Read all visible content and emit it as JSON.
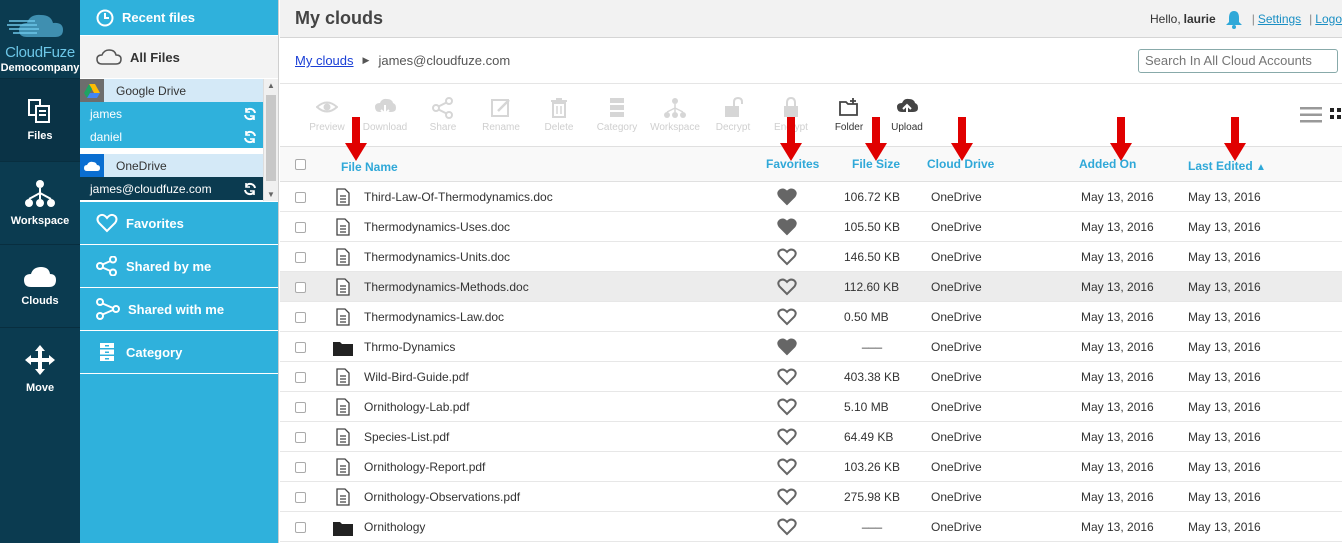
{
  "brand": {
    "name": "CloudFuze",
    "company": "Democompany"
  },
  "rail": [
    {
      "label": "Files",
      "icon": "files-icon"
    },
    {
      "label": "Workspace",
      "icon": "workspace-icon"
    },
    {
      "label": "Clouds",
      "icon": "cloud-icon"
    },
    {
      "label": "Move",
      "icon": "move-icon"
    }
  ],
  "panel": {
    "recent": "Recent files",
    "all_files": "All Files",
    "clouds": [
      {
        "name": "Google Drive",
        "accounts": [
          "james",
          "daniel"
        ]
      },
      {
        "name": "OneDrive",
        "accounts": [
          "james@cloudfuze.com"
        ]
      }
    ],
    "favorites": "Favorites",
    "shared_by_me": "Shared by me",
    "shared_with_me": "Shared with me",
    "category": "Category"
  },
  "header": {
    "title": "My clouds",
    "hello": "Hello,",
    "user": "laurie",
    "settings": "Settings",
    "logout": "Logo"
  },
  "breadcrumb": {
    "root": "My clouds",
    "current": "james@cloudfuze.com"
  },
  "search": {
    "placeholder": "Search In All Cloud Accounts"
  },
  "toolbar": [
    {
      "label": "Preview",
      "icon": "eye-icon",
      "enabled": false
    },
    {
      "label": "Download",
      "icon": "download-icon",
      "enabled": false
    },
    {
      "label": "Share",
      "icon": "share-icon",
      "enabled": false
    },
    {
      "label": "Rename",
      "icon": "rename-icon",
      "enabled": false
    },
    {
      "label": "Delete",
      "icon": "trash-icon",
      "enabled": false
    },
    {
      "label": "Category",
      "icon": "category-icon",
      "enabled": false
    },
    {
      "label": "Workspace",
      "icon": "workspace-icon",
      "enabled": false
    },
    {
      "label": "Decrypt",
      "icon": "unlock-icon",
      "enabled": false
    },
    {
      "label": "Encrypt",
      "icon": "lock-icon",
      "enabled": false
    },
    {
      "label": "Folder",
      "icon": "new-folder-icon",
      "enabled": true
    },
    {
      "label": "Upload",
      "icon": "upload-icon",
      "enabled": true
    }
  ],
  "table": {
    "columns": {
      "name": "File Name",
      "favorites": "Favorites",
      "size": "File Size",
      "drive": "Cloud Drive",
      "added": "Added On",
      "edited": "Last Edited",
      "sort_indicator": "▲"
    },
    "rows": [
      {
        "name": "Third-Law-Of-Thermodynamics.doc",
        "type": "file",
        "fav": true,
        "size": "106.72 KB",
        "drive": "OneDrive",
        "added": "May 13, 2016",
        "edited": "May 13, 2016"
      },
      {
        "name": "Thermodynamics-Uses.doc",
        "type": "file",
        "fav": true,
        "size": "105.50 KB",
        "drive": "OneDrive",
        "added": "May 13, 2016",
        "edited": "May 13, 2016"
      },
      {
        "name": "Thermodynamics-Units.doc",
        "type": "file",
        "fav": false,
        "size": "146.50 KB",
        "drive": "OneDrive",
        "added": "May 13, 2016",
        "edited": "May 13, 2016"
      },
      {
        "name": "Thermodynamics-Methods.doc",
        "type": "file",
        "fav": false,
        "size": "112.60 KB",
        "drive": "OneDrive",
        "added": "May 13, 2016",
        "edited": "May 13, 2016",
        "highlight": true
      },
      {
        "name": "Thermodynamics-Law.doc",
        "type": "file",
        "fav": false,
        "size": "0.50 MB",
        "drive": "OneDrive",
        "added": "May 13, 2016",
        "edited": "May 13, 2016"
      },
      {
        "name": "Thrmo-Dynamics",
        "type": "folder",
        "fav": true,
        "size": "___",
        "drive": "OneDrive",
        "added": "May 13, 2016",
        "edited": "May 13, 2016"
      },
      {
        "name": "Wild-Bird-Guide.pdf",
        "type": "file",
        "fav": false,
        "size": "403.38 KB",
        "drive": "OneDrive",
        "added": "May 13, 2016",
        "edited": "May 13, 2016"
      },
      {
        "name": "Ornithology-Lab.pdf",
        "type": "file",
        "fav": false,
        "size": "5.10 MB",
        "drive": "OneDrive",
        "added": "May 13, 2016",
        "edited": "May 13, 2016"
      },
      {
        "name": "Species-List.pdf",
        "type": "file",
        "fav": false,
        "size": "64.49 KB",
        "drive": "OneDrive",
        "added": "May 13, 2016",
        "edited": "May 13, 2016"
      },
      {
        "name": "Ornithology-Report.pdf",
        "type": "file",
        "fav": false,
        "size": "103.26 KB",
        "drive": "OneDrive",
        "added": "May 13, 2016",
        "edited": "May 13, 2016"
      },
      {
        "name": "Ornithology-Observations.pdf",
        "type": "file",
        "fav": false,
        "size": "275.98 KB",
        "drive": "OneDrive",
        "added": "May 13, 2016",
        "edited": "May 13, 2016"
      },
      {
        "name": "Ornithology",
        "type": "folder",
        "fav": false,
        "size": "___",
        "drive": "OneDrive",
        "added": "May 13, 2016",
        "edited": "May 13, 2016"
      }
    ]
  },
  "colors": {
    "accent": "#2fb1dc",
    "rail": "#0b3b50",
    "annotation_arrow": "#e00000"
  }
}
